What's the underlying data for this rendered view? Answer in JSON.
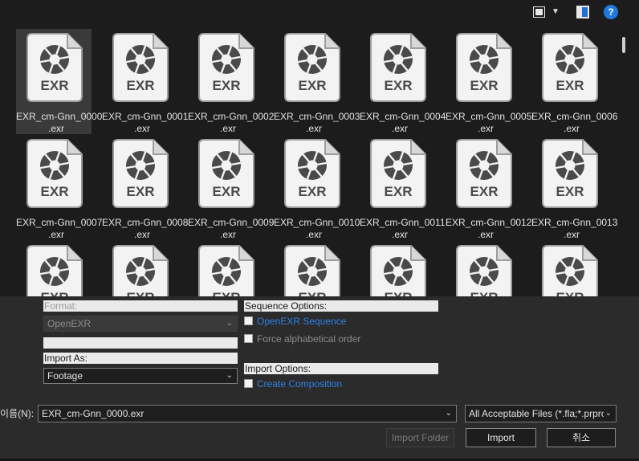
{
  "toolbar": {
    "view_icon": "thumbnail-view-icon",
    "view_menu_icon": "chevron-down-icon",
    "preview_pane_icon": "preview-pane-icon",
    "help_label": "?"
  },
  "files": [
    {
      "label": "EXR_cm-Gnn_0000.exr",
      "type_label": "EXR",
      "selected": true
    },
    {
      "label": "EXR_cm-Gnn_0001.exr",
      "type_label": "EXR"
    },
    {
      "label": "EXR_cm-Gnn_0002.exr",
      "type_label": "EXR"
    },
    {
      "label": "EXR_cm-Gnn_0003.exr",
      "type_label": "EXR"
    },
    {
      "label": "EXR_cm-Gnn_0004.exr",
      "type_label": "EXR"
    },
    {
      "label": "EXR_cm-Gnn_0005.exr",
      "type_label": "EXR"
    },
    {
      "label": "EXR_cm-Gnn_0006.exr",
      "type_label": "EXR"
    },
    {
      "label": "EXR_cm-Gnn_0007.exr",
      "type_label": "EXR"
    },
    {
      "label": "EXR_cm-Gnn_0008.exr",
      "type_label": "EXR"
    },
    {
      "label": "EXR_cm-Gnn_0009.exr",
      "type_label": "EXR"
    },
    {
      "label": "EXR_cm-Gnn_0010.exr",
      "type_label": "EXR"
    },
    {
      "label": "EXR_cm-Gnn_0011.exr",
      "type_label": "EXR"
    },
    {
      "label": "EXR_cm-Gnn_0012.exr",
      "type_label": "EXR"
    },
    {
      "label": "EXR_cm-Gnn_0013.exr",
      "type_label": "EXR"
    },
    {
      "label": "",
      "type_label": "EXR"
    },
    {
      "label": "",
      "type_label": "EXR"
    },
    {
      "label": "",
      "type_label": "EXR"
    },
    {
      "label": "",
      "type_label": "EXR"
    },
    {
      "label": "",
      "type_label": "EXR"
    },
    {
      "label": "",
      "type_label": "EXR"
    },
    {
      "label": "",
      "type_label": "EXR"
    }
  ],
  "options": {
    "format_label": "Format:",
    "format_value": "OpenEXR",
    "import_as_label": "Import As:",
    "import_as_value": "Footage",
    "sequence_options_label": "Sequence Options:",
    "openexr_sequence_label": "OpenEXR Sequence",
    "force_alphabetical_label": "Force alphabetical order",
    "import_options_label": "Import Options:",
    "create_composition_label": "Create Composition"
  },
  "footer": {
    "filename_label": "이름(N):",
    "filename_value": "EXR_cm-Gnn_0000.exr",
    "filetype_value": "All Acceptable Files (*.fla;*.prproj",
    "import_folder_label": "Import Folder",
    "import_label": "Import",
    "cancel_label": "취소"
  },
  "colors": {
    "background": "#1c1c1c",
    "panel": "#2b2b2b",
    "link": "#2f82e8",
    "help": "#1f7ae0",
    "selection": "#3a3a3a"
  }
}
